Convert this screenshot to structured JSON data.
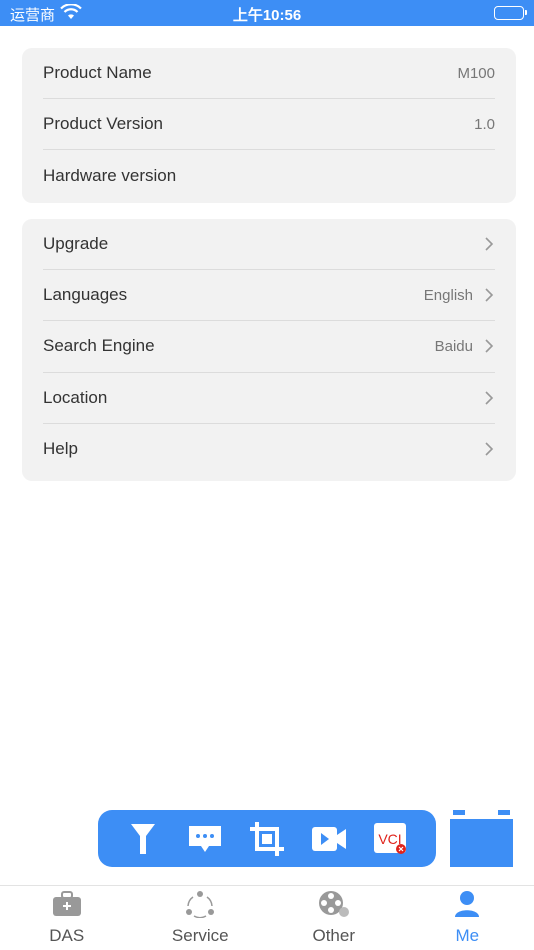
{
  "status_bar": {
    "carrier": "运营商",
    "time": "上午10:56",
    "battery_level": 1.0
  },
  "info_card": {
    "rows": [
      {
        "label": "Product Name",
        "value": "M100"
      },
      {
        "label": "Product Version",
        "value": "1.0"
      },
      {
        "label": "Hardware version",
        "value": ""
      }
    ]
  },
  "settings_card": {
    "rows": [
      {
        "label": "Upgrade",
        "value": ""
      },
      {
        "label": "Languages",
        "value": "English"
      },
      {
        "label": "Search Engine",
        "value": "Baidu"
      },
      {
        "label": "Location",
        "value": ""
      },
      {
        "label": "Help",
        "value": ""
      }
    ]
  },
  "toolbar": {
    "items": [
      {
        "icon": "filter-icon"
      },
      {
        "icon": "message-icon"
      },
      {
        "icon": "crop-icon"
      },
      {
        "icon": "video-icon"
      },
      {
        "icon": "vci-icon",
        "text": "VCI"
      }
    ]
  },
  "tabbar": {
    "tabs": [
      {
        "label": "DAS",
        "icon": "toolbox-icon",
        "active": false
      },
      {
        "label": "Service",
        "icon": "share-icon",
        "active": false
      },
      {
        "label": "Other",
        "icon": "film-reel-icon",
        "active": false
      },
      {
        "label": "Me",
        "icon": "person-icon",
        "active": true
      }
    ]
  },
  "colors": {
    "accent": "#3d8ef5",
    "card_bg": "#f2f2f2",
    "text": "#333333",
    "secondary": "#777777"
  }
}
